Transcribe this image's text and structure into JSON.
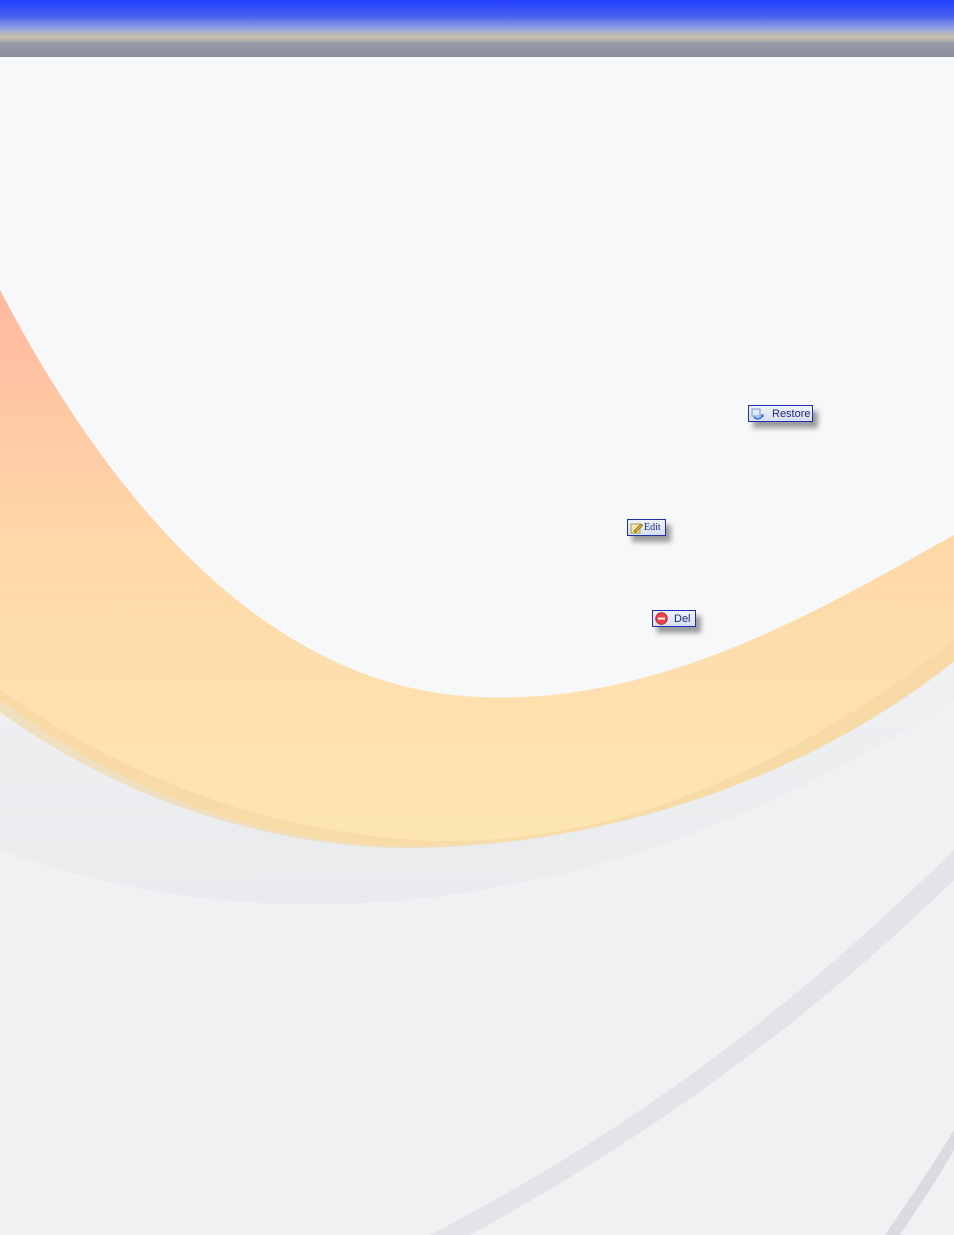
{
  "colors": {
    "header_blue": "#2240ff",
    "header_gray": "#8c8e9c",
    "button_border": "#1f2fb0",
    "swoosh_orange": "#ffcf9e",
    "background": "#f7f8f9"
  },
  "buttons": {
    "restore": {
      "label": "Restore",
      "icon": "restore-icon"
    },
    "edit": {
      "label": "Edit",
      "icon": "edit-icon"
    },
    "del": {
      "label": "Del",
      "icon": "delete-icon"
    }
  }
}
